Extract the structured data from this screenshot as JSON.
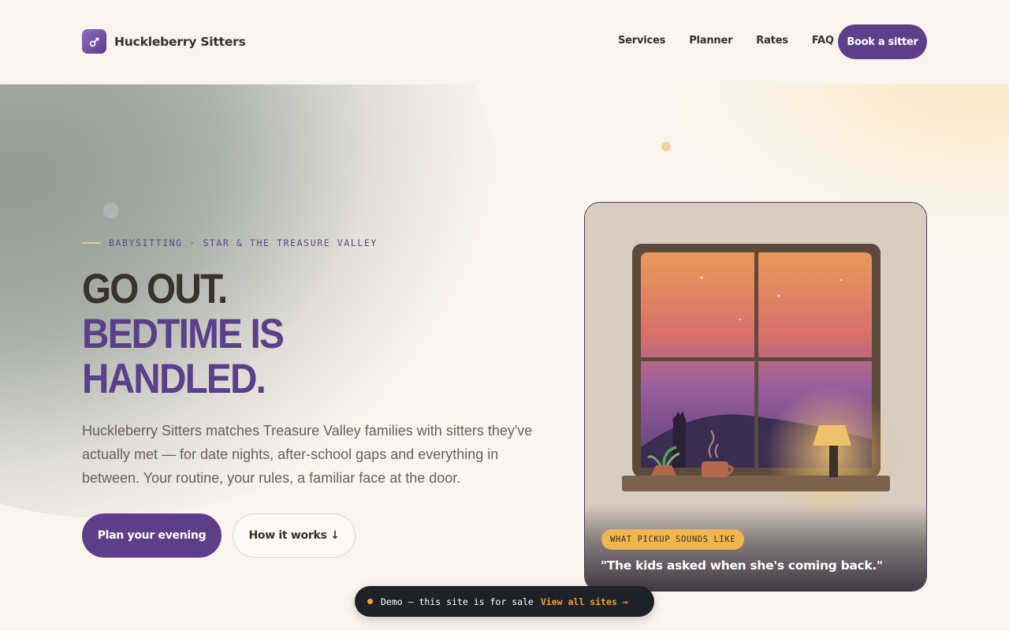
{
  "header": {
    "brand": "Huckleberry Sitters",
    "nav": [
      "Services",
      "Planner",
      "Rates",
      "FAQ"
    ],
    "cta": "Book a sitter"
  },
  "hero": {
    "eyebrow": "BABYSITTING · STAR & THE TREASURE VALLEY",
    "headline_line1": "GO OUT.",
    "headline_line2": "BEDTIME IS",
    "headline_line3": "HANDLED.",
    "lede": "Huckleberry Sitters matches Treasure Valley families with sitters they've actually met — for date nights, after-school gaps and everything in between. Your routine, your rules, a familiar face at the door.",
    "primary_cta": "Plan your evening",
    "secondary_cta": "How it works ↓"
  },
  "card": {
    "pill": "WHAT PICKUP SOUNDS LIKE",
    "quote": "\"The kids asked when she's coming back.\""
  },
  "demo_bar": {
    "text": "Demo — this site is for sale",
    "link": "View all sites →"
  },
  "colors": {
    "brand_purple": "#5d3f89",
    "accent_yellow": "#efb64f",
    "demo_accent": "#f0a03a"
  }
}
